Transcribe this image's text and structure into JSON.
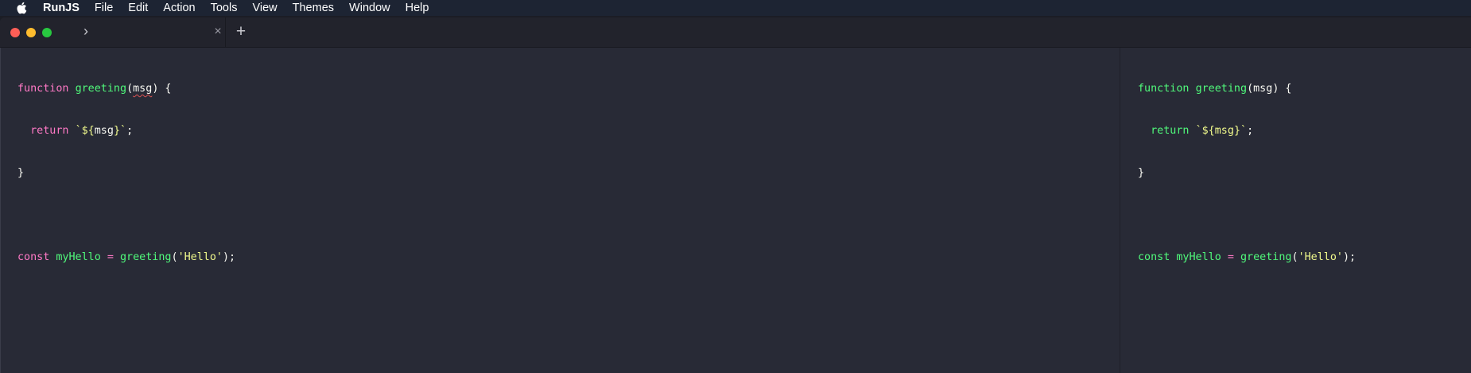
{
  "menubar": {
    "app_name": "RunJS",
    "items": [
      "File",
      "Edit",
      "Action",
      "Tools",
      "View",
      "Themes",
      "Window",
      "Help"
    ]
  },
  "tabbar": {
    "tab_chevron": "›",
    "tab_close": "×",
    "add_tab": "+"
  },
  "editor": {
    "lines": [
      {
        "t1": "function",
        "t2": "greeting",
        "t3": "(",
        "t4": "msg",
        "t5": ") {"
      },
      {
        "indent": "  ",
        "kw": "return",
        "sp": " ",
        "s1": "`${",
        "s2": "msg",
        "s3": "}`",
        "end": ";"
      },
      {
        "text": "}"
      },
      {
        "text": ""
      },
      {
        "kw": "const",
        "var": "myHello",
        "op": "=",
        "fn": "greeting",
        "p1": "(",
        "str": "'Hello'",
        "p2": ");"
      }
    ]
  },
  "result": {
    "lines": [
      {
        "t1": "function",
        "t2": "greeting",
        "t3": "(",
        "t4": "msg",
        "t5": ") {"
      },
      {
        "indent": "  ",
        "kw": "return",
        "s1": "`${",
        "s2": "msg",
        "s3": "}`",
        "end": ";"
      },
      {
        "text": "}"
      },
      {
        "text": ""
      },
      {
        "kw": "const",
        "var": "myHello",
        "op": "=",
        "fn": "greeting",
        "p1": "(",
        "str": "'Hello'",
        "p2": ");"
      }
    ]
  },
  "colors": {
    "background": "#282a36",
    "keyword": "#ff79c6",
    "function": "#50fa7b",
    "string": "#f1fa8c",
    "text": "#f8f8f2"
  },
  "icons": {
    "apple": "apple-icon",
    "close": "close-icon",
    "add": "plus-icon",
    "chevron": "chevron-right-icon"
  }
}
